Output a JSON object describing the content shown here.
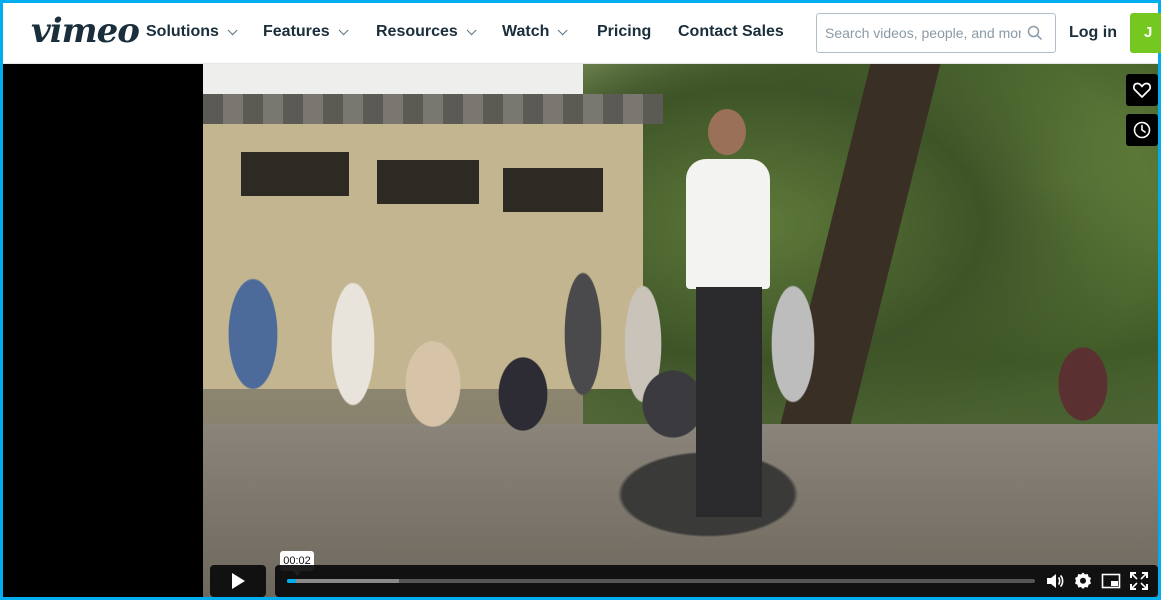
{
  "header": {
    "logo": "vimeo",
    "nav": [
      {
        "label": "Solutions",
        "dropdown": true
      },
      {
        "label": "Features",
        "dropdown": true
      },
      {
        "label": "Resources",
        "dropdown": true
      },
      {
        "label": "Watch",
        "dropdown": true
      },
      {
        "label": "Pricing",
        "dropdown": false
      },
      {
        "label": "Contact Sales",
        "dropdown": false
      }
    ],
    "search": {
      "placeholder": "Search videos, people, and more",
      "value": ""
    },
    "login_label": "Log in",
    "join_label": "J"
  },
  "player": {
    "side_buttons": [
      {
        "icon": "heart-icon"
      },
      {
        "icon": "clock-icon"
      }
    ],
    "time_tooltip": "00:02",
    "progress_played_fraction": 0.012,
    "progress_loaded_fraction": 0.15,
    "controls": [
      "volume-icon",
      "settings-icon",
      "picture-in-picture-icon",
      "fullscreen-icon"
    ]
  },
  "colors": {
    "accent": "#00adef",
    "brand_dark": "#1a2e3b",
    "join_green": "#74c81f"
  }
}
